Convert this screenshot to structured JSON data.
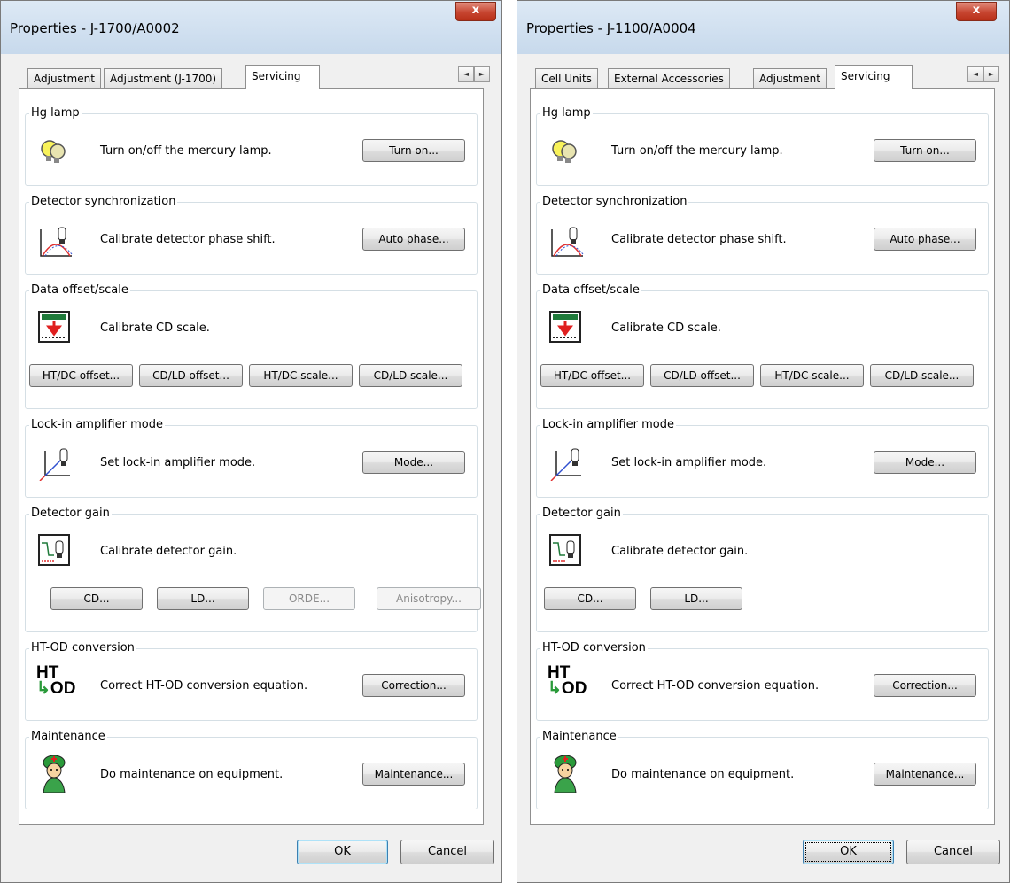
{
  "left": {
    "title": "Properties - J-1700/A0002",
    "close_glyph": "x",
    "tabs": [
      "Adjustment",
      "Adjustment (J-1700)",
      "Servicing"
    ],
    "active_tab": "Servicing",
    "scroll_left": "◄",
    "scroll_right": "►",
    "groups": {
      "hg_lamp": {
        "label": "Hg lamp",
        "desc": "Turn on/off the mercury lamp.",
        "button": "Turn on..."
      },
      "detector_sync": {
        "label": "Detector synchronization",
        "desc": "Calibrate detector phase shift.",
        "button": "Auto phase..."
      },
      "data_offset": {
        "label": "Data offset/scale",
        "desc": "Calibrate CD scale.",
        "buttons": [
          "HT/DC offset...",
          "CD/LD offset...",
          "HT/DC scale...",
          "CD/LD scale..."
        ]
      },
      "lockin": {
        "label": "Lock-in amplifier mode",
        "desc": "Set lock-in amplifier mode.",
        "button": "Mode..."
      },
      "det_gain": {
        "label": "Detector gain",
        "desc": "Calibrate detector gain.",
        "buttons": [
          "CD...",
          "LD...",
          "ORDE...",
          "Anisotropy..."
        ]
      },
      "htod": {
        "label": "HT-OD conversion",
        "desc": "Correct HT-OD conversion equation.",
        "button": "Correction..."
      },
      "maintenance": {
        "label": "Maintenance",
        "desc": "Do maintenance on equipment.",
        "button": "Maintenance..."
      }
    },
    "ok": "OK",
    "cancel": "Cancel"
  },
  "right": {
    "title": "Properties - J-1100/A0004",
    "close_glyph": "x",
    "tabs": [
      "Cell Units",
      "External Accessories",
      "Adjustment",
      "Servicing"
    ],
    "active_tab": "Servicing",
    "scroll_left": "◄",
    "scroll_right": "►",
    "groups": {
      "hg_lamp": {
        "label": "Hg lamp",
        "desc": "Turn on/off the mercury lamp.",
        "button": "Turn on..."
      },
      "detector_sync": {
        "label": "Detector synchronization",
        "desc": "Calibrate detector phase shift.",
        "button": "Auto phase..."
      },
      "data_offset": {
        "label": "Data offset/scale",
        "desc": "Calibrate CD scale.",
        "buttons": [
          "HT/DC offset...",
          "CD/LD offset...",
          "HT/DC scale...",
          "CD/LD scale..."
        ]
      },
      "lockin": {
        "label": "Lock-in amplifier mode",
        "desc": "Set lock-in amplifier mode.",
        "button": "Mode..."
      },
      "det_gain": {
        "label": "Detector gain",
        "desc": "Calibrate detector gain.",
        "buttons": [
          "CD...",
          "LD..."
        ]
      },
      "htod": {
        "label": "HT-OD conversion",
        "desc": "Correct HT-OD conversion equation.",
        "button": "Correction..."
      },
      "maintenance": {
        "label": "Maintenance",
        "desc": "Do maintenance on equipment.",
        "button": "Maintenance..."
      }
    },
    "ok": "OK",
    "cancel": "Cancel"
  },
  "icons": {
    "hg_lamp": "lamp-bulbs-icon",
    "detector_sync": "phase-shift-icon",
    "data_offset": "cd-scale-icon",
    "lockin": "lockin-axes-icon",
    "det_gain": "detector-gain-icon",
    "htod": "ht-od-icon",
    "maintenance": "maintenance-worker-icon"
  },
  "htod_icon_text": {
    "top": "HT",
    "bottom": "OD",
    "arrow": "↳"
  },
  "colors": {
    "dialog_bg": "#f0f0f0",
    "close_red": "#c74530",
    "default_button_border": "#3c7fb1"
  }
}
